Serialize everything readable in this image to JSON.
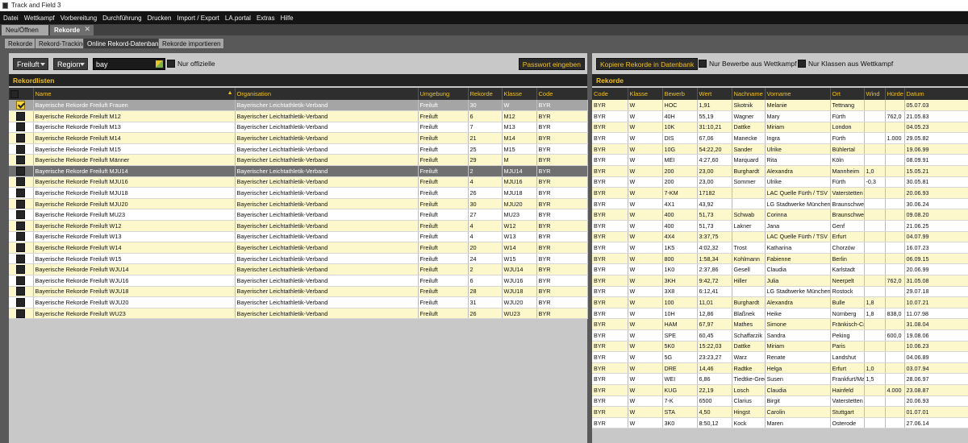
{
  "app": {
    "title": "Track and Field 3"
  },
  "menu": [
    "Datei",
    "Wettkampf",
    "Vorbereitung",
    "Durchführung",
    "Drucken",
    "Import / Export",
    "LA.portal",
    "Extras",
    "Hilfe"
  ],
  "doc_tabs": [
    {
      "label": "Neu/Öffnen"
    },
    {
      "label": "Rekorde"
    }
  ],
  "sub_tabs": [
    "Rekorde",
    "Rekord-Tracking",
    "Online Rekord-Datenbank",
    "Rekorde importieren"
  ],
  "left": {
    "filter_umgebung": "Freiluft",
    "filter_region": "Region",
    "search_value": "bay",
    "only_official_label": "Nur offizielle",
    "password_button": "Passwort eingeben",
    "header": "Rekordlisten",
    "columns": [
      "",
      "Name",
      "Organisation",
      "Umgebung",
      "Rekorde",
      "Klasse",
      "Code"
    ],
    "rows": [
      {
        "checked": true,
        "name": "Bayerische Rekorde Freiluft Frauen",
        "org": "Bayerischer Leichtathletik-Verband",
        "env": "Freiluft",
        "count": "30",
        "cls": "W",
        "code": "BYR"
      },
      {
        "checked": false,
        "name": "Bayerische Rekorde Freiluft M12",
        "org": "Bayerischer Leichtathletik-Verband",
        "env": "Freiluft",
        "count": "6",
        "cls": "M12",
        "code": "BYR"
      },
      {
        "checked": false,
        "name": "Bayerische Rekorde Freiluft M13",
        "org": "Bayerischer Leichtathletik-Verband",
        "env": "Freiluft",
        "count": "7",
        "cls": "M13",
        "code": "BYR"
      },
      {
        "checked": false,
        "name": "Bayerische Rekorde Freiluft M14",
        "org": "Bayerischer Leichtathletik-Verband",
        "env": "Freiluft",
        "count": "21",
        "cls": "M14",
        "code": "BYR"
      },
      {
        "checked": false,
        "name": "Bayerische Rekorde Freiluft M15",
        "org": "Bayerischer Leichtathletik-Verband",
        "env": "Freiluft",
        "count": "25",
        "cls": "M15",
        "code": "BYR"
      },
      {
        "checked": false,
        "name": "Bayerische Rekorde Freiluft Männer",
        "org": "Bayerischer Leichtathletik-Verband",
        "env": "Freiluft",
        "count": "29",
        "cls": "M",
        "code": "BYR"
      },
      {
        "checked": false,
        "name": "Bayerische Rekorde Freiluft MJU14",
        "org": "Bayerischer Leichtathletik-Verband",
        "env": "Freiluft",
        "count": "2",
        "cls": "MJU14",
        "code": "BYR"
      },
      {
        "checked": false,
        "name": "Bayerische Rekorde Freiluft MJU16",
        "org": "Bayerischer Leichtathletik-Verband",
        "env": "Freiluft",
        "count": "4",
        "cls": "MJU16",
        "code": "BYR"
      },
      {
        "checked": false,
        "name": "Bayerische Rekorde Freiluft MJU18",
        "org": "Bayerischer Leichtathletik-Verband",
        "env": "Freiluft",
        "count": "26",
        "cls": "MJU18",
        "code": "BYR"
      },
      {
        "checked": false,
        "name": "Bayerische Rekorde Freiluft MJU20",
        "org": "Bayerischer Leichtathletik-Verband",
        "env": "Freiluft",
        "count": "30",
        "cls": "MJU20",
        "code": "BYR"
      },
      {
        "checked": false,
        "name": "Bayerische Rekorde Freiluft MU23",
        "org": "Bayerischer Leichtathletik-Verband",
        "env": "Freiluft",
        "count": "27",
        "cls": "MU23",
        "code": "BYR"
      },
      {
        "checked": false,
        "name": "Bayerische Rekorde Freiluft W12",
        "org": "Bayerischer Leichtathletik-Verband",
        "env": "Freiluft",
        "count": "4",
        "cls": "W12",
        "code": "BYR"
      },
      {
        "checked": false,
        "name": "Bayerische Rekorde Freiluft W13",
        "org": "Bayerischer Leichtathletik-Verband",
        "env": "Freiluft",
        "count": "4",
        "cls": "W13",
        "code": "BYR"
      },
      {
        "checked": false,
        "name": "Bayerische Rekorde Freiluft W14",
        "org": "Bayerischer Leichtathletik-Verband",
        "env": "Freiluft",
        "count": "20",
        "cls": "W14",
        "code": "BYR"
      },
      {
        "checked": false,
        "name": "Bayerische Rekorde Freiluft W15",
        "org": "Bayerischer Leichtathletik-Verband",
        "env": "Freiluft",
        "count": "24",
        "cls": "W15",
        "code": "BYR"
      },
      {
        "checked": false,
        "name": "Bayerische Rekorde Freiluft WJU14",
        "org": "Bayerischer Leichtathletik-Verband",
        "env": "Freiluft",
        "count": "2",
        "cls": "WJU14",
        "code": "BYR"
      },
      {
        "checked": false,
        "name": "Bayerische Rekorde Freiluft WJU16",
        "org": "Bayerischer Leichtathletik-Verband",
        "env": "Freiluft",
        "count": "6",
        "cls": "WJU16",
        "code": "BYR"
      },
      {
        "checked": false,
        "name": "Bayerische Rekorde Freiluft WJU18",
        "org": "Bayerischer Leichtathletik-Verband",
        "env": "Freiluft",
        "count": "28",
        "cls": "WJU18",
        "code": "BYR"
      },
      {
        "checked": false,
        "name": "Bayerische Rekorde Freiluft WJU20",
        "org": "Bayerischer Leichtathletik-Verband",
        "env": "Freiluft",
        "count": "31",
        "cls": "WJU20",
        "code": "BYR"
      },
      {
        "checked": false,
        "name": "Bayerische Rekorde Freiluft WU23",
        "org": "Bayerischer Leichtathletik-Verband",
        "env": "Freiluft",
        "count": "26",
        "cls": "WU23",
        "code": "BYR"
      }
    ]
  },
  "right": {
    "copy_button": "Kopiere Rekorde in Datenbank",
    "only_events_label": "Nur Bewerbe aus Wettkampf",
    "only_classes_label": "Nur Klassen aus Wettkampf",
    "header": "Rekorde",
    "columns": [
      "Code",
      "Klasse",
      "Bewerb",
      "Wert",
      "Nachname",
      "Vorname",
      "Ort",
      "Wind",
      "Hürde",
      "Datum"
    ],
    "rows": [
      [
        "BYR",
        "W",
        "HOC",
        "1,91",
        "Skotnik",
        "Melanie",
        "Tettnang",
        "",
        "",
        "05.07.03"
      ],
      [
        "BYR",
        "W",
        "40H",
        "55,19",
        "Wagner",
        "Mary",
        "Fürth",
        "",
        "762,0",
        "21.05.83"
      ],
      [
        "BYR",
        "W",
        "10K",
        "31:10,21",
        "Dattke",
        "Miriam",
        "London",
        "",
        "",
        "04.05.23"
      ],
      [
        "BYR",
        "W",
        "DIS",
        "67,06",
        "Manecke",
        "Ingra",
        "Fürth",
        "",
        "1.000",
        "29.05.82"
      ],
      [
        "BYR",
        "W",
        "10G",
        "54:22,20",
        "Sander",
        "Ulrike",
        "Bühlertal",
        "",
        "",
        "19.06.99"
      ],
      [
        "BYR",
        "W",
        "MEI",
        "4:27,60",
        "Marquard",
        "Rita",
        "Köln",
        "",
        "",
        "08.09.91"
      ],
      [
        "BYR",
        "W",
        "200",
        "23,00",
        "Burghardt",
        "Alexandra",
        "Mannheim",
        "1,0",
        "",
        "15.05.21"
      ],
      [
        "BYR",
        "W",
        "200",
        "23,00",
        "Sommer",
        "Ulrike",
        "Fürth",
        "-0,3",
        "",
        "30.05.81"
      ],
      [
        "BYR",
        "W",
        "7-KM",
        "17182",
        "",
        "LAC Quelle Fürth / TSV",
        "Vaterstetten",
        "",
        "",
        "20.06.93"
      ],
      [
        "BYR",
        "W",
        "4X1",
        "43,92",
        "",
        "LG Stadtwerke München",
        "Braunschweig",
        "",
        "",
        "30.06.24"
      ],
      [
        "BYR",
        "W",
        "400",
        "51,73",
        "Schwab",
        "Corinna",
        "Braunschweig",
        "",
        "",
        "09.08.20"
      ],
      [
        "BYR",
        "W",
        "400",
        "51,73",
        "Lakner",
        "Jana",
        "Genf",
        "",
        "",
        "21.06.25"
      ],
      [
        "BYR",
        "W",
        "4X4",
        "3:37,75",
        "",
        "LAC Quelle Fürth / TSV",
        "Erfurt",
        "",
        "",
        "04.07.99"
      ],
      [
        "BYR",
        "W",
        "1K5",
        "4:02,32",
        "Trost",
        "Katharina",
        "Chorzów",
        "",
        "",
        "16.07.23"
      ],
      [
        "BYR",
        "W",
        "800",
        "1:58,34",
        "Kohlmann",
        "Fabienne",
        "Berlin",
        "",
        "",
        "06.09.15"
      ],
      [
        "BYR",
        "W",
        "1K0",
        "2:37,86",
        "Gesell",
        "Claudia",
        "Karlstadt",
        "",
        "",
        "20.06.99"
      ],
      [
        "BYR",
        "W",
        "3KH",
        "9:42,72",
        "Hiller",
        "Julia",
        "Neerpelt",
        "",
        "762,0",
        "31.05.08"
      ],
      [
        "BYR",
        "W",
        "3X8",
        "6:12,41",
        "",
        "LG Stadtwerke München",
        "Rostock",
        "",
        "",
        "29.07.18"
      ],
      [
        "BYR",
        "W",
        "100",
        "11,01",
        "Burghardt",
        "Alexandra",
        "Bulle",
        "1,8",
        "",
        "10.07.21"
      ],
      [
        "BYR",
        "W",
        "10H",
        "12,86",
        "Blaßnek",
        "Heike",
        "Nürnberg",
        "1,8",
        "838,0",
        "11.07.98"
      ],
      [
        "BYR",
        "W",
        "HAM",
        "67,97",
        "Mathes",
        "Simone",
        "Fränkisch-Crumbach",
        "",
        "",
        "31.08.04"
      ],
      [
        "BYR",
        "W",
        "SPE",
        "60,45",
        "Schaffarzik",
        "Sandra",
        "Peking",
        "",
        "600,0",
        "19.08.06"
      ],
      [
        "BYR",
        "W",
        "5K0",
        "15:22,03",
        "Dattke",
        "Miriam",
        "Paris",
        "",
        "",
        "10.06.23"
      ],
      [
        "BYR",
        "W",
        "5G",
        "23:23,27",
        "Warz",
        "Renate",
        "Landshut",
        "",
        "",
        "04.06.89"
      ],
      [
        "BYR",
        "W",
        "DRE",
        "14,46",
        "Radtke",
        "Helga",
        "Erfurt",
        "1,0",
        "",
        "03.07.94"
      ],
      [
        "BYR",
        "W",
        "WEI",
        "6,86",
        "Tiedtke-Green",
        "Susen",
        "Frankfurt/Main",
        "1,5",
        "",
        "28.06.97"
      ],
      [
        "BYR",
        "W",
        "KUG",
        "22,19",
        "Losch",
        "Claudia",
        "Hainfeld",
        "",
        "4.000",
        "23.08.87"
      ],
      [
        "BYR",
        "W",
        "7-K",
        "6500",
        "Clarius",
        "Birgit",
        "Vaterstetten",
        "",
        "",
        "20.06.93"
      ],
      [
        "BYR",
        "W",
        "STA",
        "4,50",
        "Hingst",
        "Carolin",
        "Stuttgart",
        "",
        "",
        "01.07.01"
      ],
      [
        "BYR",
        "W",
        "3K0",
        "8:50,12",
        "Kock",
        "Maren",
        "Osterode",
        "",
        "",
        "27.06.14"
      ]
    ]
  },
  "colors": {
    "accent": "#f0c020",
    "menubar": "#141414",
    "row_yellow": "#fcf8cc",
    "row_selected": "#707070"
  }
}
